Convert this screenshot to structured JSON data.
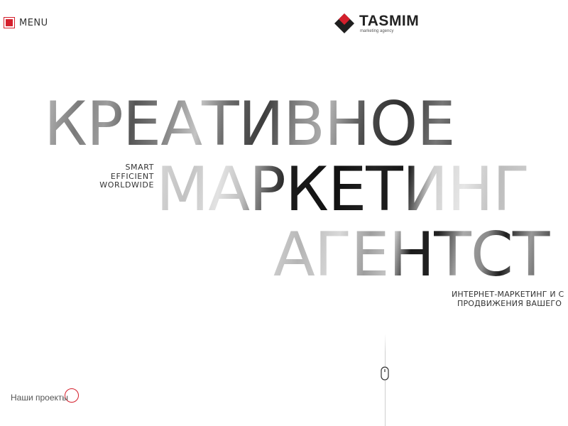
{
  "header": {
    "menu_label": "MENU",
    "logo": {
      "name": "TASMIM",
      "tagline": "marketing agency",
      "icon": "diamond-logo-icon"
    }
  },
  "hero": {
    "line1": "КРЕАТИВНОЕ",
    "line2": "МАРКЕТИНГ",
    "line3": "АГЕНТСТ",
    "tagline": [
      "SMART",
      "EFFICIENT",
      "WORLDWIDE"
    ],
    "subtitle_line1": "ИНТЕРНЕТ-МАРКЕТИНГ И С",
    "subtitle_line2": "ПРОДВИЖЕНИЯ ВАШЕГО"
  },
  "footer": {
    "projects_label": "Наши проекты",
    "scroll_icon": "mouse-scroll-icon"
  },
  "colors": {
    "accent": "#d41f2c",
    "text": "#333333",
    "background": "#ffffff"
  }
}
